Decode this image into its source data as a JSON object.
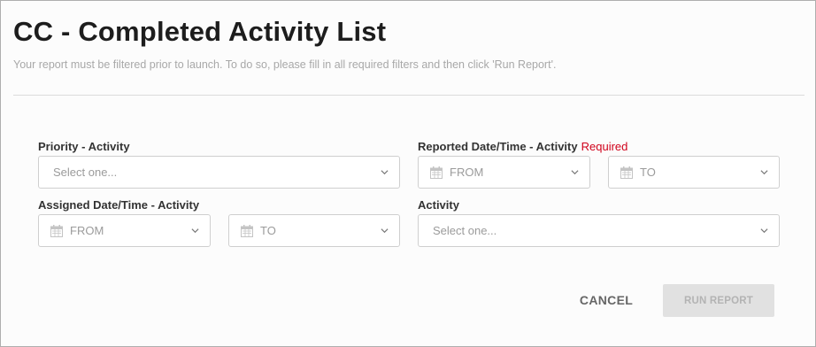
{
  "header": {
    "title": "CC - Completed Activity List",
    "subtitle": "Your report must be filtered prior to launch. To do so, please fill in all required filters and then click 'Run Report'."
  },
  "filters": {
    "priority": {
      "label": "Priority - Activity",
      "placeholder": "Select one..."
    },
    "reported": {
      "label": "Reported Date/Time - Activity",
      "required_label": "Required",
      "from_placeholder": "FROM",
      "to_placeholder": "TO"
    },
    "assigned": {
      "label": "Assigned Date/Time - Activity",
      "from_placeholder": "FROM",
      "to_placeholder": "TO"
    },
    "activity": {
      "label": "Activity",
      "placeholder": "Select one..."
    }
  },
  "actions": {
    "cancel_label": "CANCEL",
    "run_label": "RUN REPORT"
  },
  "colors": {
    "required": "#d0021b",
    "run_button_bg": "#e1e1e1",
    "placeholder": "#9b9b9b"
  },
  "icons": {
    "date_icon": "calendar-icon",
    "dropdown_icon": "chevron-down-icon"
  }
}
